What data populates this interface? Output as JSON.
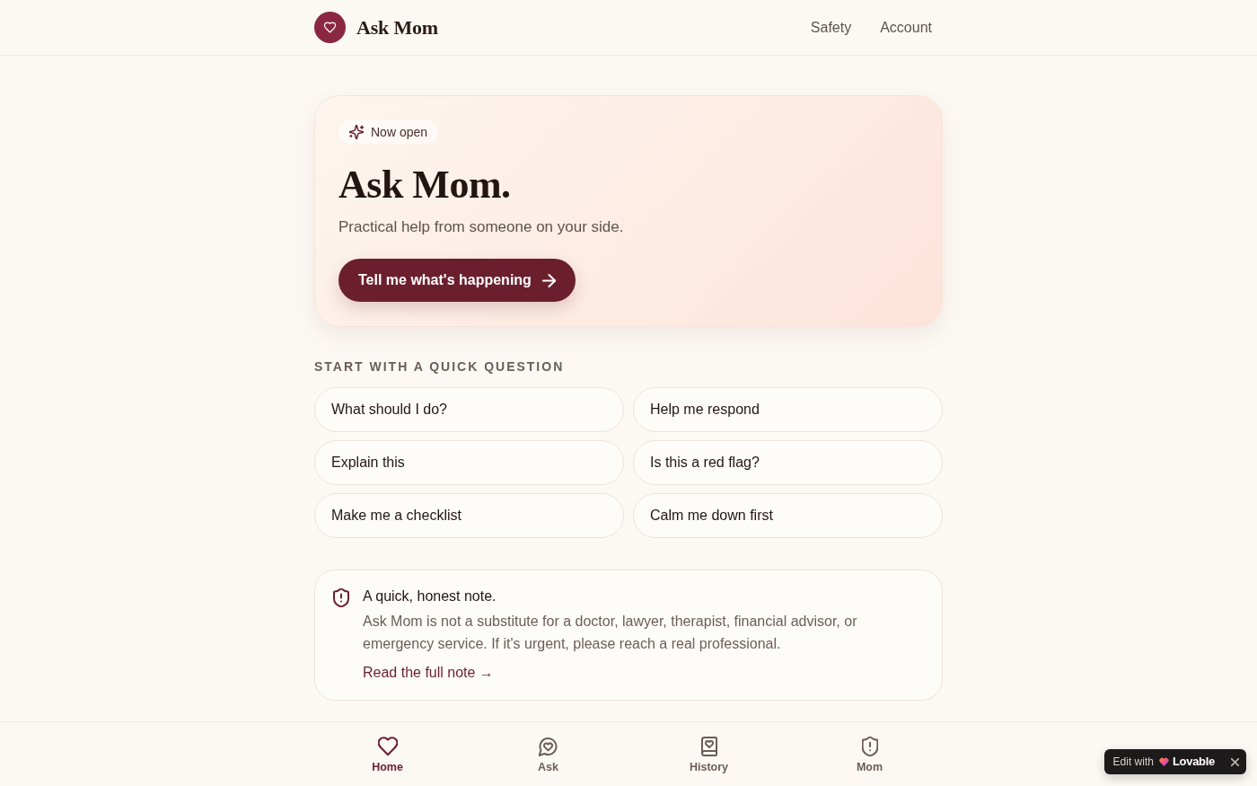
{
  "header": {
    "brand": "Ask Mom",
    "nav": [
      {
        "label": "Safety"
      },
      {
        "label": "Account"
      }
    ]
  },
  "hero": {
    "badge": "Now open",
    "title": "Ask Mom.",
    "subtitle": "Practical help from someone on your side.",
    "cta": "Tell me what's happening"
  },
  "quick_questions": {
    "heading": "START WITH A QUICK QUESTION",
    "items": [
      "What should I do?",
      "Help me respond",
      "Explain this",
      "Is this a red flag?",
      "Make me a checklist",
      "Calm me down first"
    ]
  },
  "note": {
    "title": "A quick, honest note.",
    "body": "Ask Mom is not a substitute for a doctor, lawyer, therapist, financial advisor, or emergency service. If it's urgent, please reach a real professional.",
    "link": "Read the full note →"
  },
  "bottom_nav": [
    {
      "label": "Home",
      "selected": true
    },
    {
      "label": "Ask",
      "selected": false
    },
    {
      "label": "History",
      "selected": false
    },
    {
      "label": "Mom",
      "selected": false
    }
  ],
  "edit_badge": {
    "prefix": "Edit with",
    "brand": "Lovable"
  }
}
